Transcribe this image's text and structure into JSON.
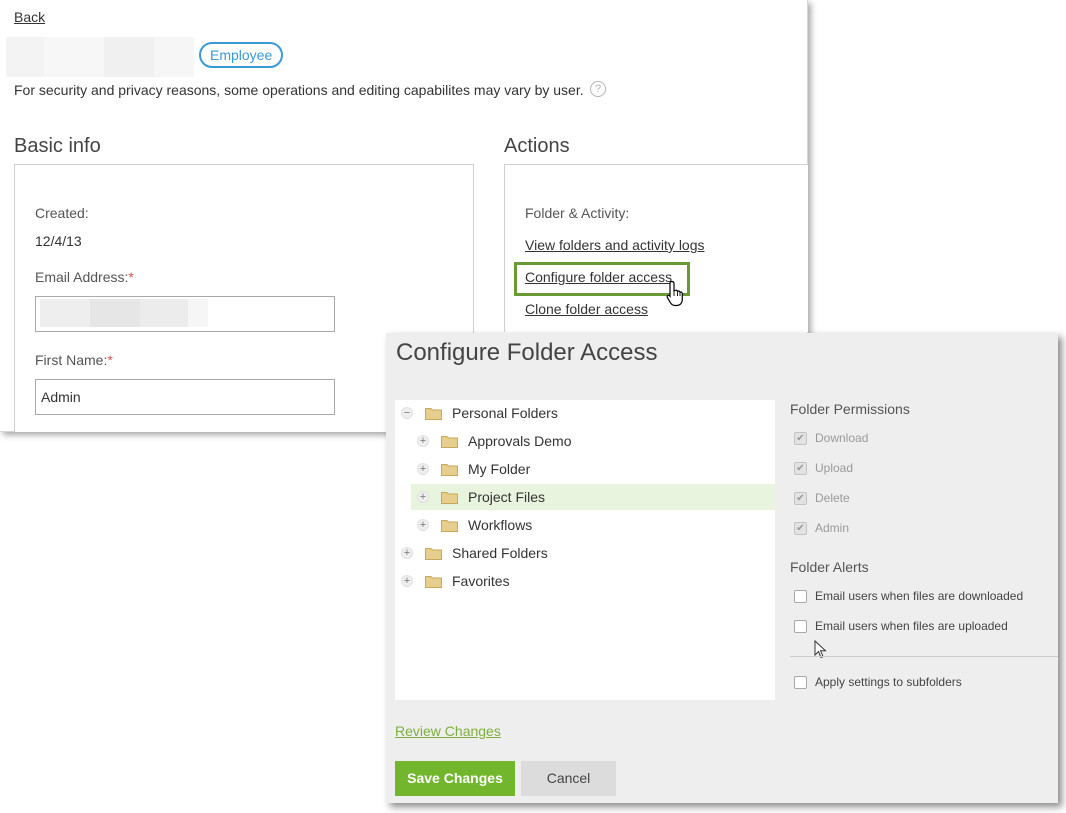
{
  "user_page": {
    "back_label": "Back",
    "role_badge": "Employee",
    "security_note": "For security and privacy reasons, some operations and editing capabilites may vary by user.",
    "help_icon": "?",
    "basic_info": {
      "title": "Basic info",
      "created_label": "Created:",
      "created_value": "12/4/13",
      "email_label": "Email Address:",
      "email_required": "*",
      "first_name_label": "First Name:",
      "first_name_required": "*",
      "first_name_value": "Admin"
    },
    "actions": {
      "title": "Actions",
      "subtitle": "Folder & Activity:",
      "links": [
        "View folders and activity logs",
        "Configure folder access",
        "Clone folder access"
      ]
    }
  },
  "modal": {
    "title": "Configure Folder Access",
    "tree": {
      "personal": {
        "label": "Personal Folders",
        "expander": "−"
      },
      "children": [
        {
          "label": "Approvals Demo",
          "expander": "+"
        },
        {
          "label": "My Folder",
          "expander": "+"
        },
        {
          "label": "Project Files",
          "expander": "+",
          "selected": true
        },
        {
          "label": "Workflows",
          "expander": "+"
        }
      ],
      "shared": {
        "label": "Shared Folders",
        "expander": "+"
      },
      "favorites": {
        "label": "Favorites",
        "expander": "+"
      }
    },
    "permissions": {
      "title": "Folder Permissions",
      "items": [
        {
          "label": "Download",
          "checked": true,
          "disabled": true
        },
        {
          "label": "Upload",
          "checked": true,
          "disabled": true
        },
        {
          "label": "Delete",
          "checked": true,
          "disabled": true
        },
        {
          "label": "Admin",
          "checked": true,
          "disabled": true
        }
      ]
    },
    "alerts": {
      "title": "Folder Alerts",
      "items": [
        {
          "label": "Email users when files are downloaded",
          "checked": false
        },
        {
          "label": "Email users when files are uploaded",
          "checked": false
        }
      ]
    },
    "apply_subfolders": {
      "label": "Apply settings to subfolders",
      "checked": false
    },
    "review_changes": "Review Changes",
    "save_label": "Save Changes",
    "cancel_label": "Cancel"
  },
  "colors": {
    "accent_green": "#71b62c",
    "badge_blue": "#3a9ad9",
    "highlight_green": "#6a9a34",
    "selected_row": "#e9f4df",
    "required_red": "#d9534f"
  },
  "icons": {
    "folder": "folder-icon",
    "help": "help-icon",
    "hand": "hand-cursor-icon",
    "arrow": "arrow-cursor-icon"
  }
}
